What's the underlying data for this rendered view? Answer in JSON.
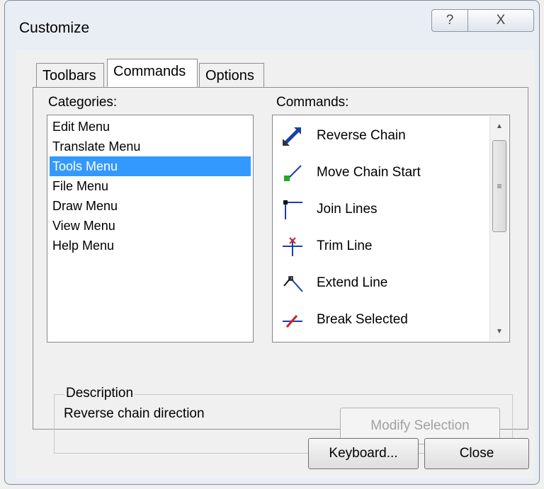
{
  "window": {
    "title": "Customize",
    "help_glyph": "?",
    "close_glyph": "X"
  },
  "tabs": [
    {
      "label": "Toolbars"
    },
    {
      "label": "Commands"
    },
    {
      "label": "Options"
    }
  ],
  "categories": {
    "label": "Categories:",
    "selected": "Tools Menu",
    "items": [
      "Edit Menu",
      "Translate Menu",
      "Tools Menu",
      "File Menu",
      "Draw Menu",
      "View Menu",
      "Help Menu"
    ]
  },
  "commands": {
    "label": "Commands:",
    "items": [
      {
        "label": "Reverse Chain",
        "icon": "reverse-chain-icon"
      },
      {
        "label": "Move Chain Start",
        "icon": "move-chain-start-icon"
      },
      {
        "label": "Join Lines",
        "icon": "join-lines-icon"
      },
      {
        "label": "Trim Line",
        "icon": "trim-line-icon"
      },
      {
        "label": "Extend Line",
        "icon": "extend-line-icon"
      },
      {
        "label": "Break Selected",
        "icon": "break-selected-icon"
      }
    ]
  },
  "description": {
    "title": "Description",
    "text": "Reverse chain direction",
    "modify_label": "Modify Selection"
  },
  "footer": {
    "keyboard_label": "Keyboard...",
    "close_label": "Close"
  },
  "colors": {
    "selection": "#3399ff",
    "accent_blue": "#1a3fa8",
    "accent_red": "#d61f1f",
    "accent_green": "#22aa22"
  }
}
